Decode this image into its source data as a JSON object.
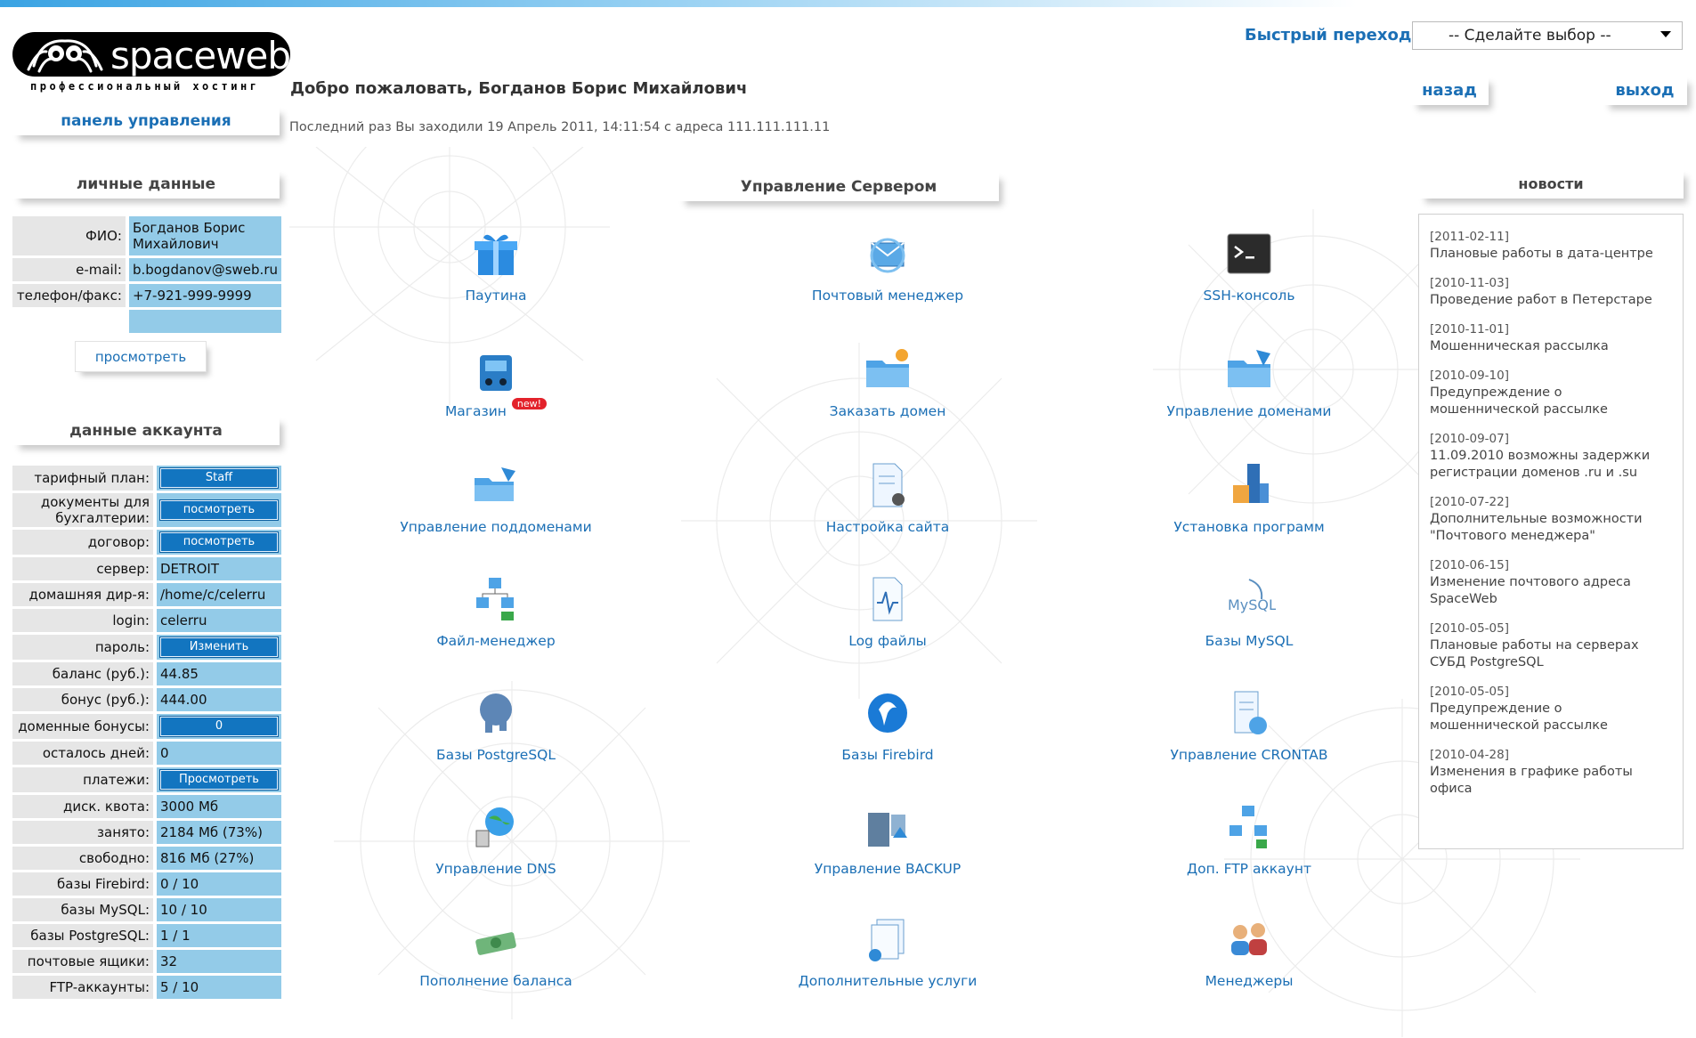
{
  "brand": {
    "name": "spaceweb",
    "tagline": "профессиональный хостинг"
  },
  "header": {
    "welcome": "Добро пожаловать, Богданов Борис Михайлович",
    "last_login": "Последний раз Вы заходили 19 Апрель 2011, 14:11:54 с адреса 111.111.111.11",
    "quick_jump_label": "Быстрый переход:",
    "quick_jump_selected": "-- Сделайте выбор --",
    "back_link": "назад",
    "logout_link": "выход"
  },
  "sidebar": {
    "panel_link": "панель управления",
    "personal": {
      "title": "личные данные",
      "rows": [
        {
          "label": "ФИО:",
          "value": "Богданов Борис Михайлович"
        },
        {
          "label": "e-mail:",
          "value": "b.bogdanov@sweb.ru"
        },
        {
          "label": "телефон/факс:",
          "value": "+7-921-999-9999"
        },
        {
          "label": "",
          "value": ""
        }
      ],
      "view_button": "просмотреть"
    },
    "account": {
      "title": "данные аккаунта",
      "rows": [
        {
          "label": "тарифный план:",
          "value": "Staff",
          "button": true
        },
        {
          "label": "документы для бухгалтерии:",
          "value": "посмотреть",
          "button": true
        },
        {
          "label": "договор:",
          "value": "посмотреть",
          "button": true
        },
        {
          "label": "сервер:",
          "value": "DETROIT"
        },
        {
          "label": "домашняя дир-я:",
          "value": "/home/c/celerru"
        },
        {
          "label": "login:",
          "value": "celerru"
        },
        {
          "label": "пароль:",
          "value": "Изменить",
          "button": true
        },
        {
          "label": "баланс (руб.):",
          "value": "44.85"
        },
        {
          "label": "бонус (руб.):",
          "value": "444.00"
        },
        {
          "label": "доменные бонусы:",
          "value": "0",
          "button": true
        },
        {
          "label": "осталось дней:",
          "value": "0"
        },
        {
          "label": "платежи:",
          "value": "Просмотреть",
          "button": true
        },
        {
          "label": "диск. квота:",
          "value": "3000 Мб"
        },
        {
          "label": "занято:",
          "value": "2184 Мб (73%)"
        },
        {
          "label": "свободно:",
          "value": "816 Мб (27%)"
        },
        {
          "label": "базы Firebird:",
          "value": "0 / 10"
        },
        {
          "label": "базы MySQL:",
          "value": "10 / 10"
        },
        {
          "label": "базы PostgreSQL:",
          "value": "1 / 1"
        },
        {
          "label": "почтовые ящики:",
          "value": "32"
        },
        {
          "label": "FTP-аккаунты:",
          "value": "5 / 10"
        }
      ]
    }
  },
  "main": {
    "title": "Управление Сервером",
    "new_badge": "new!",
    "items": [
      {
        "label": "Паутина",
        "icon": "gift-box-icon"
      },
      {
        "label": "Почтовый менеджер",
        "icon": "mail-sync-icon"
      },
      {
        "label": "SSH-консоль",
        "icon": "terminal-icon"
      },
      {
        "label": "Магазин",
        "icon": "shop-icon"
      },
      {
        "label": "Заказать домен",
        "icon": "folder-star-icon"
      },
      {
        "label": "Управление доменами",
        "icon": "folder-arrow-icon"
      },
      {
        "label": "Управление поддоменами",
        "icon": "subfolder-icon"
      },
      {
        "label": "Настройка сайта",
        "icon": "document-gear-icon"
      },
      {
        "label": "Установка программ",
        "icon": "install-icon"
      },
      {
        "label": "Файл-менеджер",
        "icon": "file-tree-icon"
      },
      {
        "label": "Log файлы",
        "icon": "log-file-icon"
      },
      {
        "label": "Базы MySQL",
        "icon": "mysql-icon"
      },
      {
        "label": "Базы PostgreSQL",
        "icon": "postgresql-icon"
      },
      {
        "label": "Базы Firebird",
        "icon": "firebird-icon"
      },
      {
        "label": "Управление CRONTAB",
        "icon": "crontab-icon"
      },
      {
        "label": "Управление DNS",
        "icon": "dns-globe-icon"
      },
      {
        "label": "Управление BACKUP",
        "icon": "backup-icon"
      },
      {
        "label": "Доп. FTP аккаунт",
        "icon": "ftp-icon"
      },
      {
        "label": "Пополнение баланса",
        "icon": "money-icon"
      },
      {
        "label": "Дополнительные услуги",
        "icon": "extra-services-icon"
      },
      {
        "label": "Менеджеры",
        "icon": "managers-icon"
      }
    ]
  },
  "news": {
    "title": "новости",
    "items": [
      {
        "date": "[2011-02-11]",
        "text": "Плановые работы в дата-центре"
      },
      {
        "date": "[2010-11-03]",
        "text": "Проведение работ в Петерстаре"
      },
      {
        "date": "[2010-11-01]",
        "text": "Мошенническая рассылка"
      },
      {
        "date": "[2010-09-10]",
        "text": "Предупреждение о мошеннической рассылке"
      },
      {
        "date": "[2010-09-07]",
        "text": "11.09.2010 возможны задержки регистрации доменов .ru и .su"
      },
      {
        "date": "[2010-07-22]",
        "text": "Дополнительные возможности \"Почтового менеджера\""
      },
      {
        "date": "[2010-06-15]",
        "text": "Изменение почтового адреса SpaceWeb"
      },
      {
        "date": "[2010-05-05]",
        "text": "Плановые работы на серверах СУБД PostgreSQL"
      },
      {
        "date": "[2010-05-05]",
        "text": "Предупреждение о мошеннической рассылке"
      },
      {
        "date": "[2010-04-28]",
        "text": "Изменения в графике работы офиса"
      }
    ]
  },
  "colors": {
    "link": "#1b6fb5",
    "cell_blue": "#93cbe8",
    "button_blue": "#1275c0",
    "label_gray": "#e6e6e6",
    "badge_red": "#e3222b"
  }
}
